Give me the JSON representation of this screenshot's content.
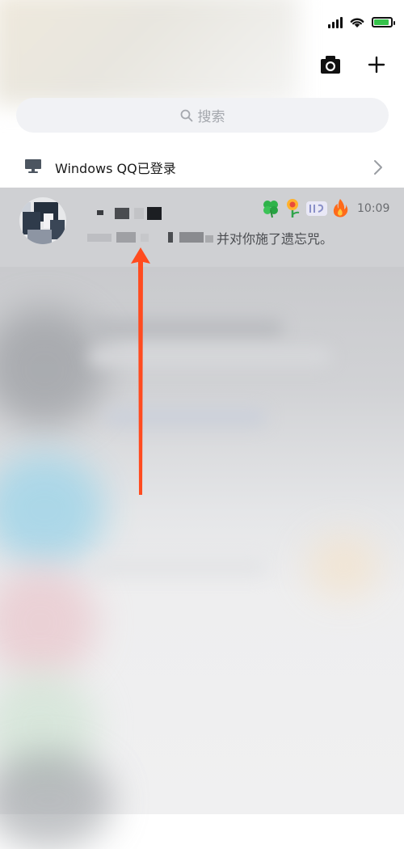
{
  "search": {
    "placeholder": "搜索"
  },
  "login_notice": {
    "label": "Windows QQ已登录"
  },
  "chat": {
    "time": "10:09",
    "preview": "并对你施了遗忘咒。",
    "badges": [
      {
        "icon": "clover-icon",
        "color": "#2fb34a"
      },
      {
        "icon": "flower-icon",
        "color": "#e94b3c"
      },
      {
        "icon": "level-badge-icon",
        "color": "#8a90c8"
      },
      {
        "icon": "fire-icon",
        "color": "#ff6a1a"
      }
    ]
  },
  "colors": {
    "chat_row_bg": "#cfd0d3",
    "search_bg": "#f1f2f5",
    "arrow": "#ff4b1f",
    "battery": "#35c24a"
  }
}
